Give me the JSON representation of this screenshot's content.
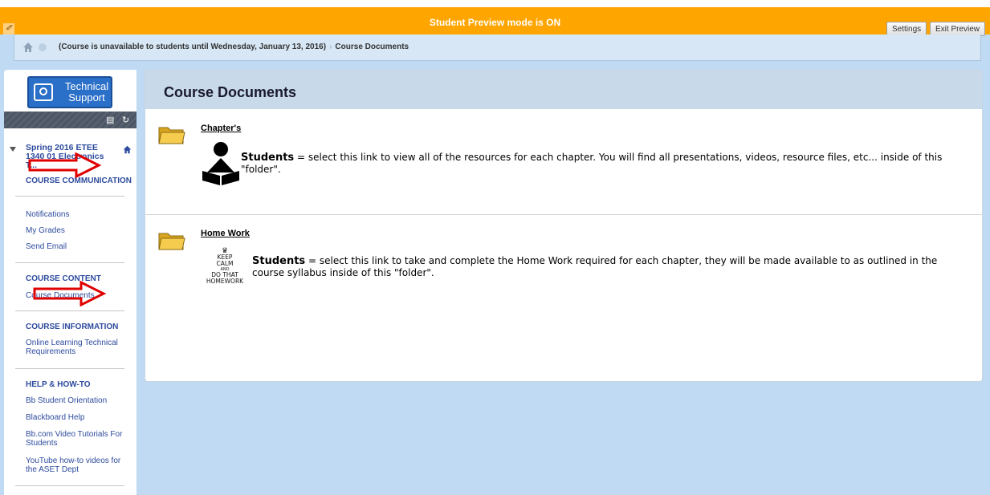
{
  "preview": {
    "text": "Student Preview mode is ON",
    "settings_label": "Settings",
    "exit_label": "Exit Preview"
  },
  "breadcrumb": {
    "course": "(Course is unavailable to students until Wednesday, January 13, 2016)",
    "current": "Course Documents"
  },
  "sidebar": {
    "logo_text": "Technical Support",
    "course_title": "Spring 2016 ETEE 1340 01 Electronics T...",
    "sections": [
      {
        "title": "COURSE COMMUNICATION",
        "items": [
          "Notifications",
          "My Grades",
          "Send Email"
        ]
      },
      {
        "title": "COURSE CONTENT",
        "items": [
          "Course Documents"
        ]
      },
      {
        "title": "COURSE INFORMATION",
        "items": [
          "Online Learning Technical Requirements"
        ]
      },
      {
        "title": "HELP & HOW-TO",
        "items": [
          "Bb Student Orientation",
          "Blackboard Help",
          "Bb.com Video Tutorials For Students",
          "YouTube how-to videos for the ASET Dept"
        ]
      }
    ]
  },
  "content": {
    "title": "Course Documents",
    "items": [
      {
        "link": "Chapter's",
        "desc_bold": "Students",
        "desc": " = select this link to view all of the resources for each chapter. You will find all presentations, videos, resource files, etc... inside of this \"folder\"."
      },
      {
        "link": "Home Work",
        "desc_bold": "Students",
        "desc": " = select this link to take and complete the Home Work required for each chapter, they will be made available to as outlined in the course syllabus inside of this \"folder\".",
        "keep_calm": [
          "KEEP",
          "CALM",
          "AND",
          "DO THAT",
          "HOMEWORK"
        ]
      }
    ]
  },
  "colors": {
    "preview_bar": "#ffa500",
    "link": "#2d4b9e",
    "background": "#bfdaf2",
    "arrow": "#e00000"
  }
}
